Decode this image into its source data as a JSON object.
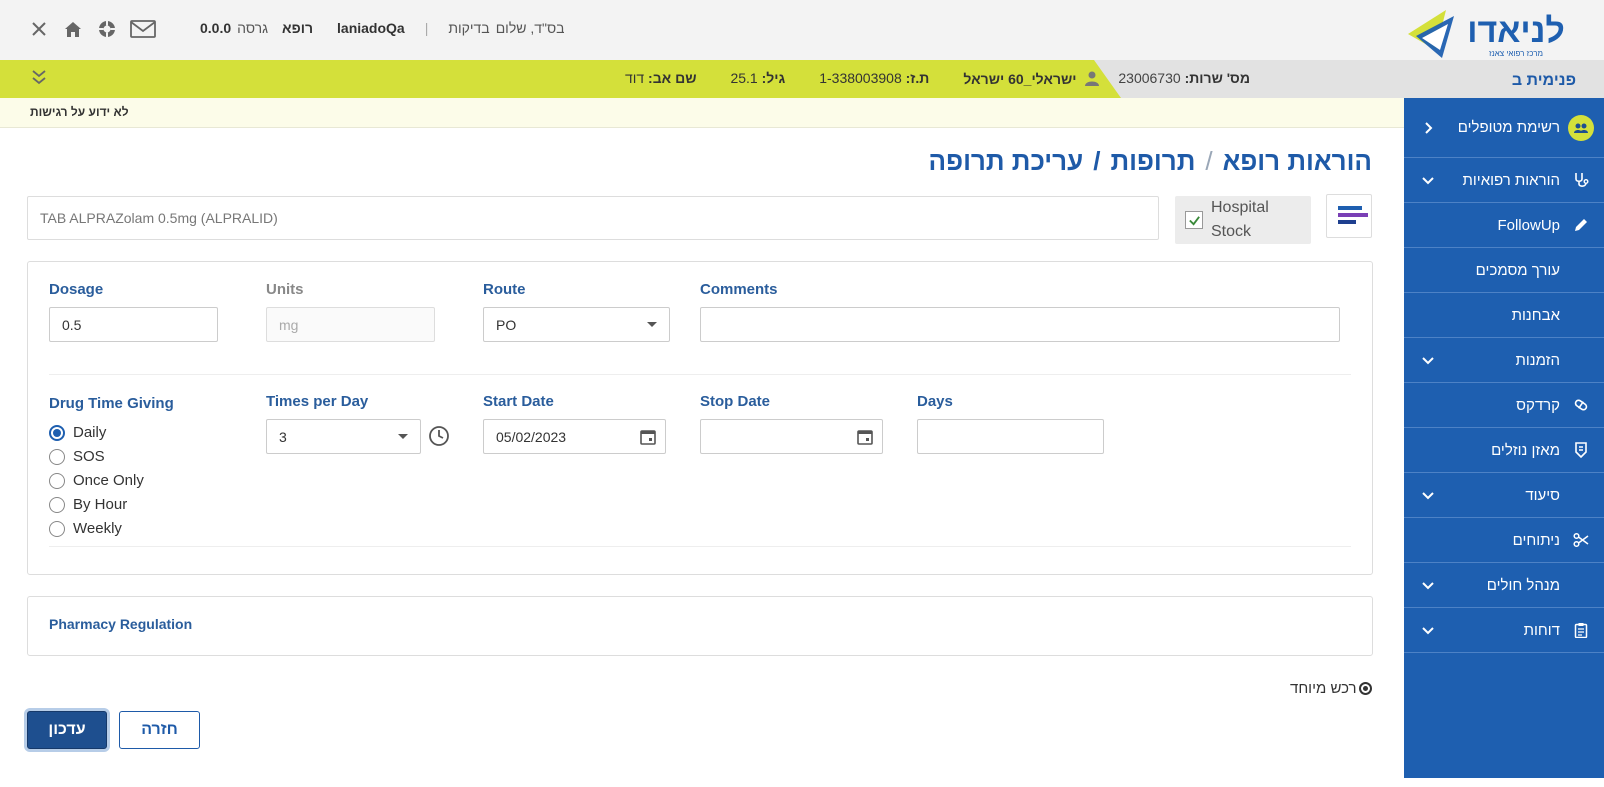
{
  "header": {
    "greeting": "בס\"ד, שלום",
    "user_role_label": "בדיקות",
    "username": "laniadoQa",
    "role": "רופא",
    "version_label": "גרסה",
    "version": "0.0.0",
    "logo_text": "לניאדו",
    "logo_subtitle": "מרכז רפואי צאנז"
  },
  "patient_bar": {
    "ward": "פנימית ב",
    "service_label": "מס' שרות:",
    "service_number": "23006730",
    "patient_name": "ישראלי_60 ישראל",
    "id_label": "ת.ז:",
    "id_number": "1-338003908",
    "age_label": "גיל:",
    "age": "25.1",
    "father_label": "שם אב:",
    "father_name": "דוד",
    "allergy_text": "לא ידוע על רגישות"
  },
  "sidebar": {
    "items": [
      {
        "label": "רשימת מטופלים",
        "icon": "patients-icon"
      },
      {
        "label": "הוראות רפואיות",
        "icon": "stethoscope-icon"
      },
      {
        "label": "FollowUp",
        "icon": "pencil-icon"
      },
      {
        "label": "עורך מסמכים",
        "icon": ""
      },
      {
        "label": "אבחנות",
        "icon": ""
      },
      {
        "label": "הזמנות",
        "icon": ""
      },
      {
        "label": "קרדקס",
        "icon": "pill-icon"
      },
      {
        "label": "מאזן נוזלים",
        "icon": "fluid-icon"
      },
      {
        "label": "סיעוד",
        "icon": ""
      },
      {
        "label": "ניתוחים",
        "icon": "scissors-icon"
      },
      {
        "label": "מנהל חולים",
        "icon": ""
      },
      {
        "label": "דוחות",
        "icon": "clipboard-icon"
      }
    ]
  },
  "breadcrumb": {
    "level1": "הוראות רופא",
    "level2": "תרופות",
    "level3": "עריכת תרופה"
  },
  "drug": {
    "name": "TAB ALPRAZolam 0.5mg (ALPRALID)",
    "stock_label_1": "Hospital",
    "stock_label_2": "Stock",
    "stock_checked": true
  },
  "form": {
    "dosage_label": "Dosage",
    "dosage_value": "0.5",
    "units_label": "Units",
    "units_placeholder": "mg",
    "route_label": "Route",
    "route_value": "PO",
    "comments_label": "Comments",
    "comments_value": "",
    "drug_time_label": "Drug Time Giving",
    "drug_time_options": [
      "Daily",
      "SOS",
      "Once Only",
      "By Hour",
      "Weekly"
    ],
    "drug_time_selected": "Daily",
    "times_per_day_label": "Times per Day",
    "times_per_day_value": "3",
    "start_date_label": "Start Date",
    "start_date_value": "05/02/2023",
    "stop_date_label": "Stop Date",
    "stop_date_value": "",
    "days_label": "Days",
    "days_value": ""
  },
  "pharmacy": {
    "title": "Pharmacy Regulation"
  },
  "special_purchase": "רכש מיוחד",
  "buttons": {
    "update": "עדכון",
    "back": "חזרה"
  },
  "colors": {
    "primary_blue": "#1e5fb0",
    "lime": "#d4e03a",
    "dark_button": "#1e4f8f"
  }
}
